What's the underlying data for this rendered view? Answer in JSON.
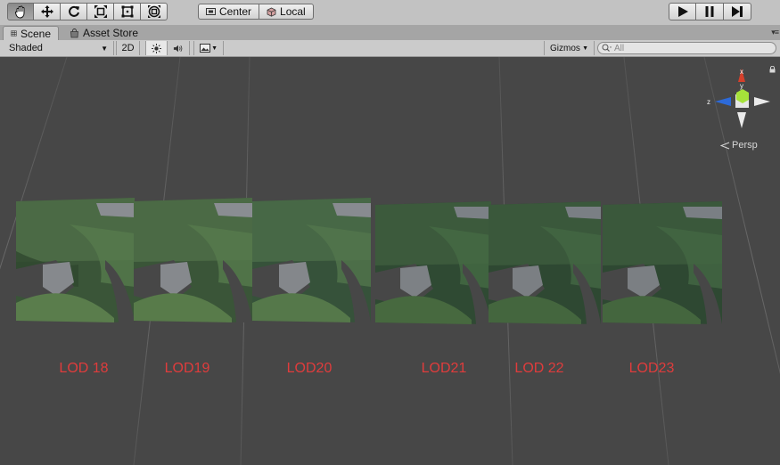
{
  "toolbar": {
    "tools": [
      {
        "name": "hand-tool",
        "icon": "hand-icon",
        "active": true
      },
      {
        "name": "move-tool",
        "icon": "move-icon",
        "active": false
      },
      {
        "name": "rotate-tool",
        "icon": "rotate-icon",
        "active": false
      },
      {
        "name": "scale-tool",
        "icon": "scale-icon",
        "active": false
      },
      {
        "name": "rect-tool",
        "icon": "rect-icon",
        "active": false
      },
      {
        "name": "transform-tool",
        "icon": "transform-icon",
        "active": false
      }
    ],
    "pivot_center_label": "Center",
    "pivot_local_label": "Local",
    "play_controls": [
      "play-icon",
      "pause-icon",
      "step-icon"
    ]
  },
  "tabs": {
    "scene_label": "Scene",
    "asset_store_label": "Asset Store"
  },
  "scene_bar": {
    "shading_mode": "Shaded",
    "mode_2d_label": "2D",
    "lighting_icon": "sun-icon",
    "audio_icon": "speaker-icon",
    "effects_icon": "image-icon",
    "gizmos_label": "Gizmos",
    "search_placeholder": "All"
  },
  "viewport": {
    "background_color": "#474747",
    "grid_color": "#5a5a5a",
    "label_color": "#e03c3c",
    "projection_label": "Persp",
    "gizmo_axes": {
      "x_label": "x",
      "y_label": "y",
      "z_label": "z"
    },
    "lod_tiles": [
      {
        "label": "LOD 18"
      },
      {
        "label": "LOD19"
      },
      {
        "label": "LOD20"
      },
      {
        "label": "LOD21"
      },
      {
        "label": "LOD 22"
      },
      {
        "label": "LOD23"
      }
    ]
  }
}
